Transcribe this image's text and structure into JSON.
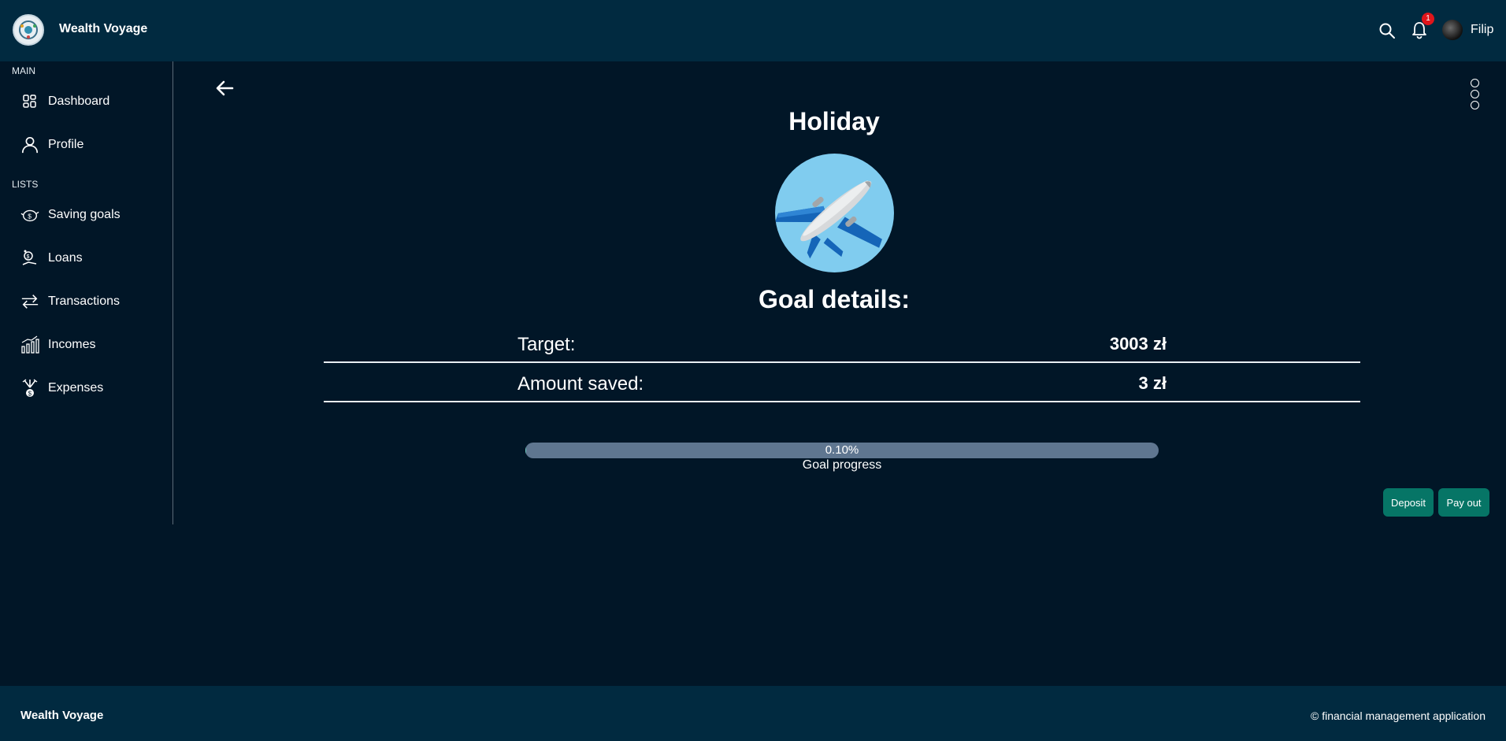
{
  "header": {
    "brand": "Wealth Voyage",
    "notification_count": "1",
    "user_name": "Filip"
  },
  "sidebar": {
    "main_label": "MAIN",
    "lists_label": "LISTS",
    "items": [
      {
        "label": "Dashboard",
        "icon": "dashboard-icon"
      },
      {
        "label": "Profile",
        "icon": "user-icon"
      },
      {
        "label": "Saving goals",
        "icon": "piggy-bank-icon"
      },
      {
        "label": "Loans",
        "icon": "loan-icon"
      },
      {
        "label": "Transactions",
        "icon": "transfer-arrows-icon"
      },
      {
        "label": "Incomes",
        "icon": "chart-up-icon"
      },
      {
        "label": "Expenses",
        "icon": "money-fly-icon"
      }
    ]
  },
  "goal": {
    "title": "Holiday",
    "image": "airplane-icon",
    "details_heading": "Goal details:",
    "target_label": "Target:",
    "target_value": "3003 zł",
    "saved_label": "Amount saved:",
    "saved_value": "3 zł",
    "progress_text": "0.10%",
    "progress_fraction": 0.001,
    "progress_caption": "Goal progress"
  },
  "actions": {
    "deposit": "Deposit",
    "pay_out": "Pay out"
  },
  "footer": {
    "brand": "Wealth Voyage",
    "copyright": "© financial management application"
  },
  "colors": {
    "background": "#011627",
    "header": "#012a40",
    "button": "#067566",
    "progress_track": "#5f7690",
    "badge": "#e0151b"
  }
}
